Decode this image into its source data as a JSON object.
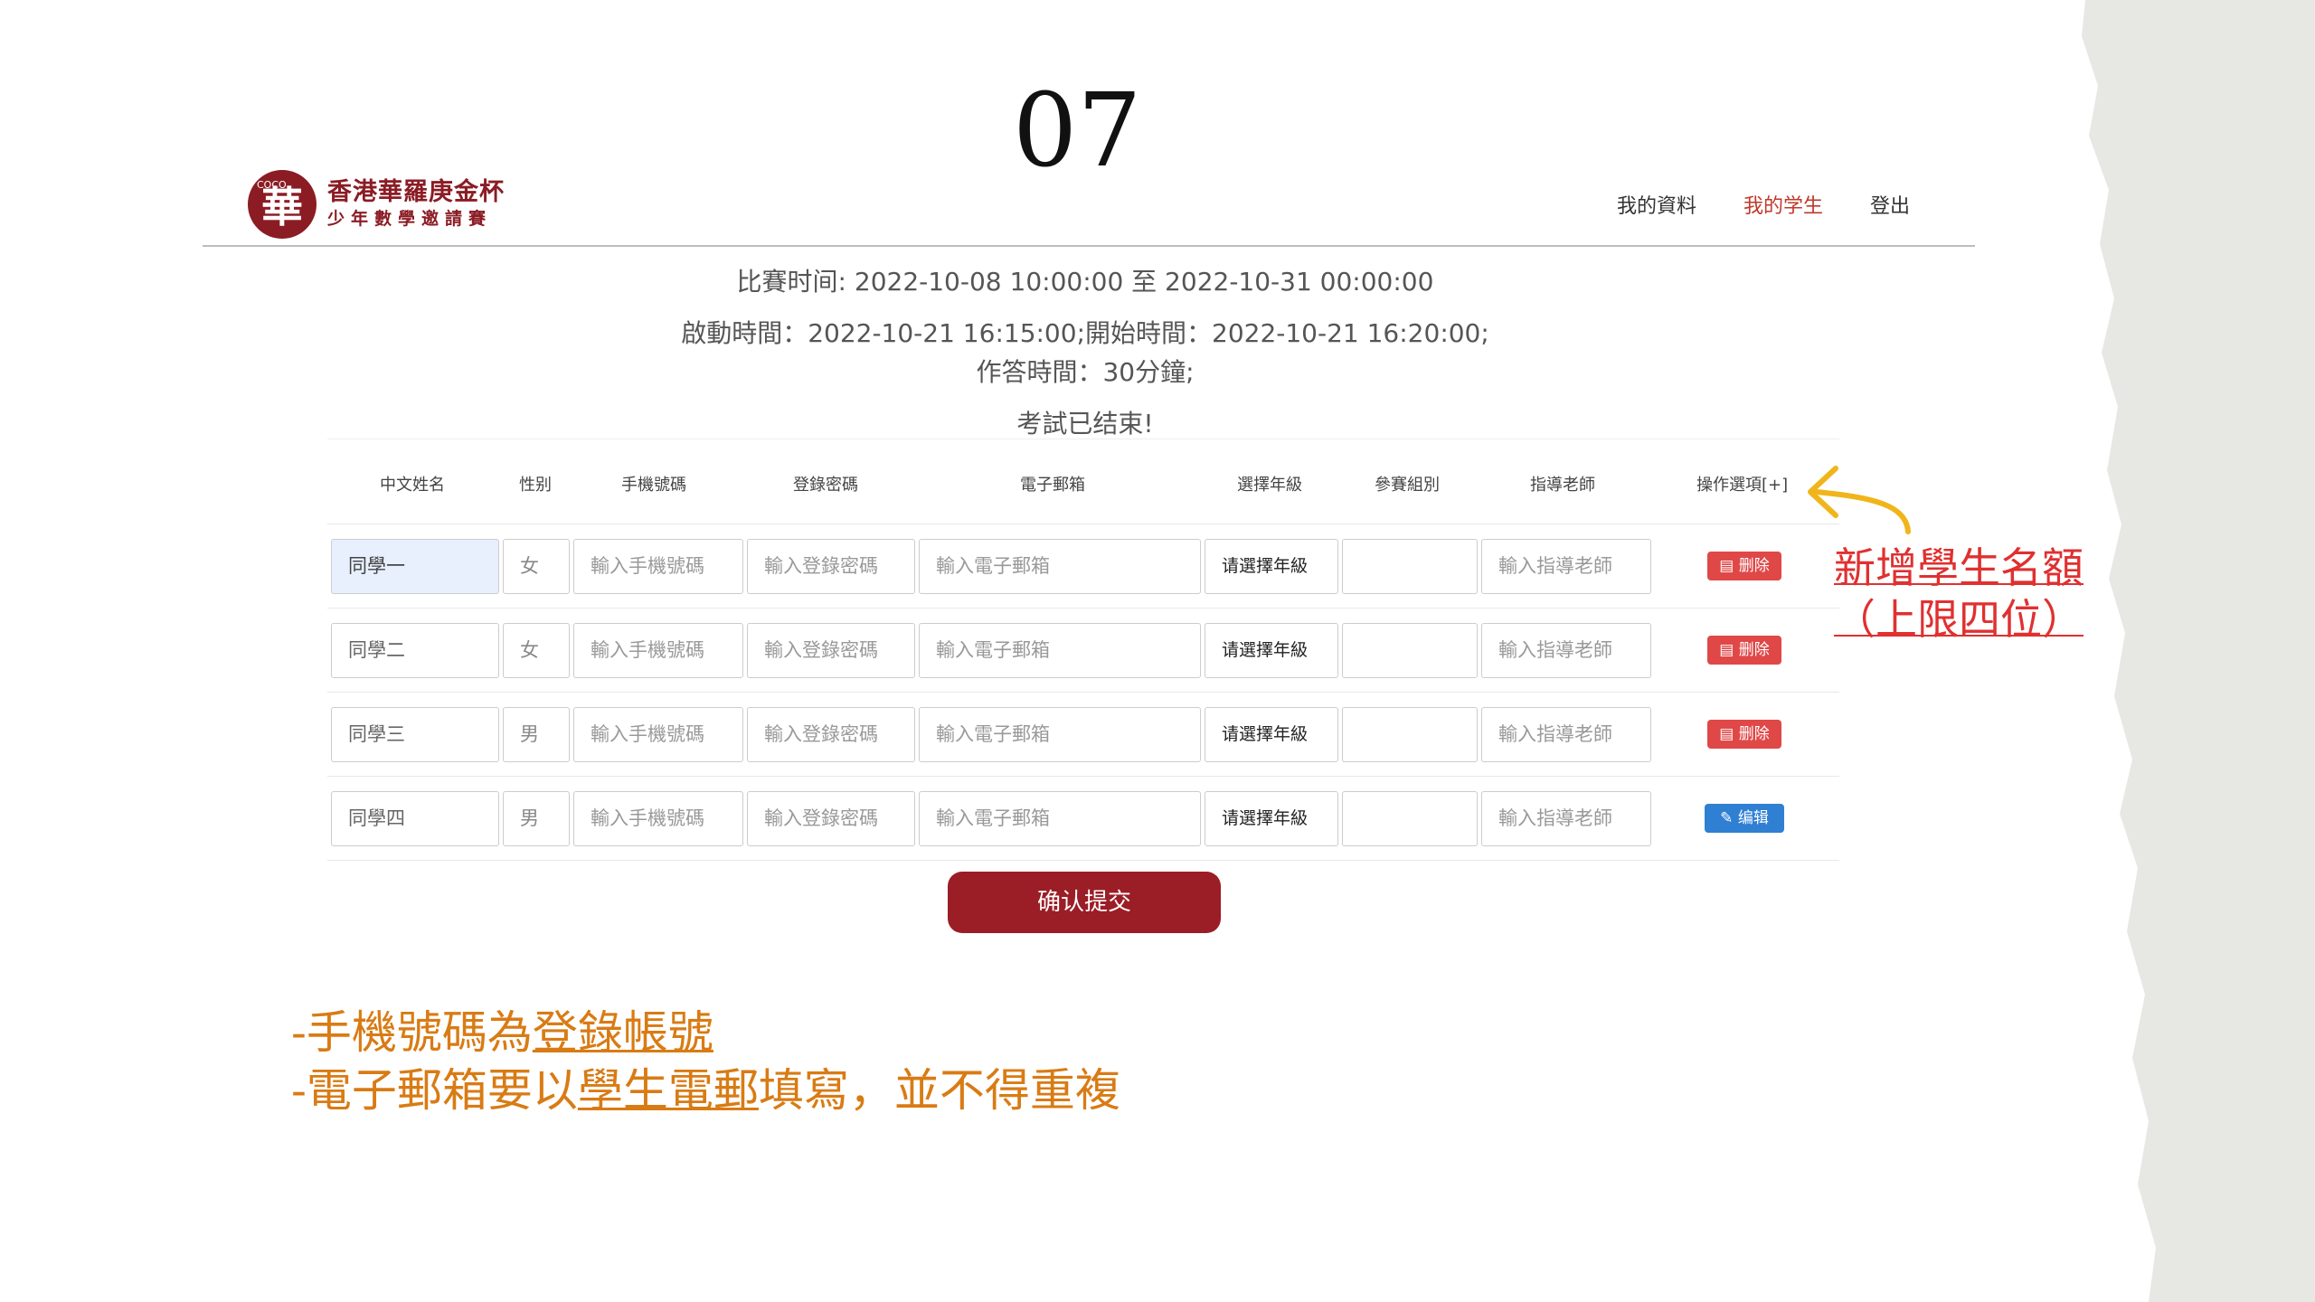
{
  "slide": {
    "number": "07"
  },
  "logo": {
    "badge": "COCO",
    "mark": "華",
    "line1": "香港華羅庚金杯",
    "line2": "少年數學邀請賽"
  },
  "nav": {
    "items": [
      {
        "label": "我的資料"
      },
      {
        "label": "我的学生"
      },
      {
        "label": "登出"
      }
    ]
  },
  "info": {
    "competition_time": "比賽时间: 2022-10-08 10:00:00 至 2022-10-31 00:00:00",
    "start_times": "啟動時間：2022-10-21 16:15:00;開始時間：2022-10-21 16:20:00;",
    "duration": "作答時間：30分鐘;",
    "status": "考試已结束!"
  },
  "table": {
    "headers": [
      "中文姓名",
      "性别",
      "手機號碼",
      "登錄密碼",
      "電子郵箱",
      "選擇年級",
      "參賽組別",
      "指導老師",
      "操作選項[+]"
    ],
    "placeholders": {
      "phone": "輸入手機號碼",
      "password": "輸入登錄密碼",
      "email": "輸入電子郵箱",
      "grade": "请選擇年級",
      "teacher": "輸入指導老師"
    },
    "rows": [
      {
        "name": "同學一",
        "gender": "女",
        "action": "删除"
      },
      {
        "name": "同學二",
        "gender": "女",
        "action": "删除"
      },
      {
        "name": "同學三",
        "gender": "男",
        "action": "删除"
      },
      {
        "name": "同學四",
        "gender": "男",
        "action": "编辑"
      }
    ]
  },
  "submit": {
    "label": "确认提交"
  },
  "annotation": {
    "line1": "新增學生名額",
    "line2": "（上限四位）"
  },
  "notes": {
    "line1_prefix": "-手機號碼為",
    "line1_emph": "登錄帳號",
    "line2_prefix": "-電子郵箱要以",
    "line2_emph": "學生電郵",
    "line2_suffix": "填寫，並不得重複"
  },
  "colors": {
    "brand": "#8b1c24",
    "delete": "#e04848",
    "edit": "#2f7fd3",
    "annotation": "#e03030",
    "notes": "#d97b14"
  }
}
